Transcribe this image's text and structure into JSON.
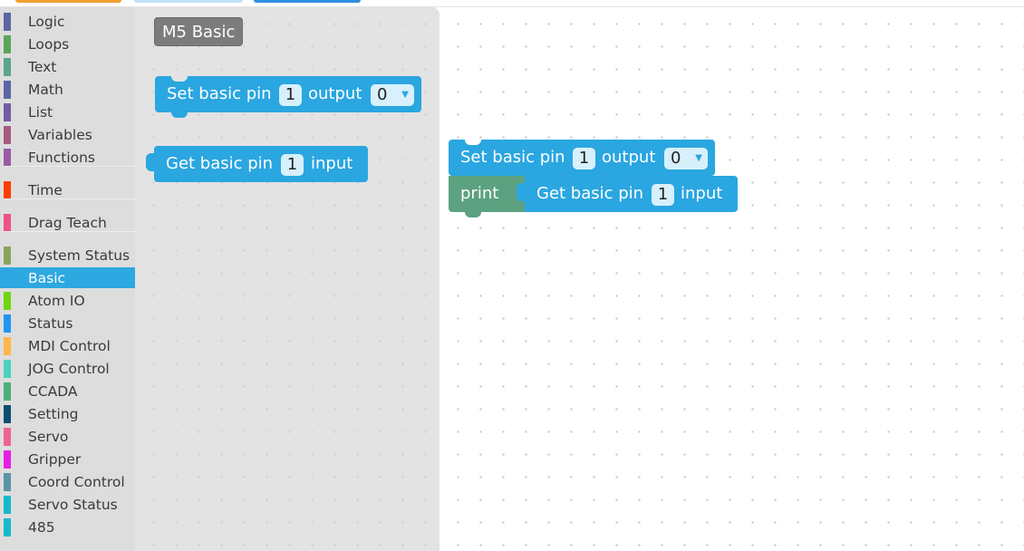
{
  "toolbox": {
    "categories": [
      {
        "label": "Logic",
        "color": "#5b67a5"
      },
      {
        "label": "Loops",
        "color": "#5ba55b"
      },
      {
        "label": "Text",
        "color": "#5ba58c"
      },
      {
        "label": "Math",
        "color": "#5b67a5"
      },
      {
        "label": "List",
        "color": "#745ba5"
      },
      {
        "label": "Variables",
        "color": "#a55b80"
      },
      {
        "label": "Functions",
        "color": "#995ba5"
      },
      {
        "label": "Time",
        "color": "#ff3d00"
      },
      {
        "label": "Drag Teach",
        "color": "#ef5283"
      },
      {
        "label": "System Status",
        "color": "#89a55b"
      },
      {
        "label": "Basic",
        "color": "#2ea8e0",
        "selected": true
      },
      {
        "label": "Atom IO",
        "color": "#6ed60d"
      },
      {
        "label": "Status",
        "color": "#2196f3"
      },
      {
        "label": "MDI Control",
        "color": "#ffb74d"
      },
      {
        "label": "JOG Control",
        "color": "#4dd0c1"
      },
      {
        "label": "CCADA",
        "color": "#4caf7a"
      },
      {
        "label": "Setting",
        "color": "#0a4f70"
      },
      {
        "label": "Servo",
        "color": "#f06292"
      },
      {
        "label": "Gripper",
        "color": "#e91ee6"
      },
      {
        "label": "Coord Control",
        "color": "#5b94a5"
      },
      {
        "label": "Servo Status",
        "color": "#17b8cc"
      },
      {
        "label": "485",
        "color": "#17b8cc"
      }
    ]
  },
  "flyout": {
    "section_label": "M5 Basic",
    "set_block": {
      "text_pre": "Set basic pin",
      "pin": "1",
      "text_mid": "output",
      "value": "0"
    },
    "get_block": {
      "text_pre": "Get basic pin",
      "pin": "1",
      "text_post": "input"
    }
  },
  "workspace": {
    "set_block": {
      "text_pre": "Set basic pin",
      "pin": "1",
      "text_mid": "output",
      "value": "0"
    },
    "print_block": {
      "label": "print"
    },
    "get_block": {
      "text_pre": "Get basic pin",
      "pin": "1",
      "text_post": "input"
    }
  },
  "colors": {
    "basic_block": "#2aa6e0",
    "print_block": "#5ca281",
    "label_block": "#7c7c7c",
    "selected_category": "#2ea8e0"
  },
  "icons": {
    "dropdown": "dropdown-arrow-icon"
  }
}
